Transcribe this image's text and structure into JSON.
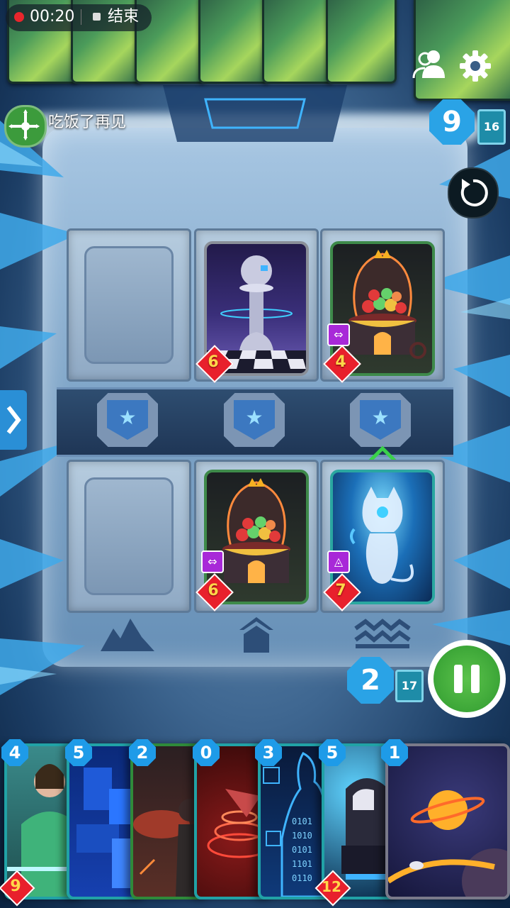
{
  "recorder": {
    "time": "00:20",
    "end_label": "结束"
  },
  "opponent": {
    "name": "吃饭了再见",
    "energy": "9",
    "deck_count": "16"
  },
  "player": {
    "energy": "2",
    "deck_count": "17"
  },
  "opponent_board": [
    {
      "slot": 1,
      "card": null
    },
    {
      "slot": 2,
      "card": {
        "art": "chess-pawn",
        "power": "6"
      }
    },
    {
      "slot": 3,
      "card": {
        "art": "gumball-machine",
        "power": "4",
        "tag": "swap-icon"
      }
    }
  ],
  "player_board": [
    {
      "slot": 1,
      "card": null
    },
    {
      "slot": 2,
      "card": {
        "art": "gumball-machine",
        "power": "6",
        "tag": "swap-icon"
      }
    },
    {
      "slot": 3,
      "card": {
        "art": "ghost-cat",
        "power": "7",
        "tag": "recycle-icon"
      }
    }
  ],
  "hand": [
    {
      "cost": "4",
      "power": "9",
      "art": "hoodie-character"
    },
    {
      "cost": "5",
      "art": "blue-blocks"
    },
    {
      "cost": "2",
      "art": "red-crowd"
    },
    {
      "cost": "0",
      "art": "red-spiral"
    },
    {
      "cost": "3",
      "art": "binary-figure"
    },
    {
      "cost": "5",
      "power": "12",
      "art": "robot"
    },
    {
      "cost": "1",
      "art": "planet"
    }
  ],
  "colors": {
    "energy": "#2aa3e6",
    "power": "#e8202c",
    "end_turn": "#3aa83a"
  }
}
